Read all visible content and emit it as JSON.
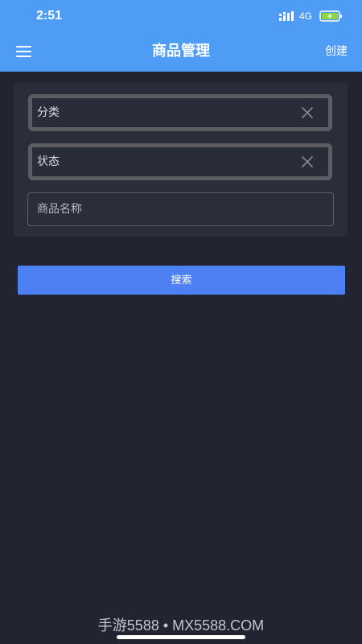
{
  "status_bar": {
    "time": "2:51",
    "network": "4G"
  },
  "header": {
    "title": "商品管理",
    "create_label": "创建",
    "menu_icon": "hamburger-menu-icon"
  },
  "filters": {
    "category": {
      "label": "分类",
      "clear_icon": "close-icon"
    },
    "status": {
      "label": "状态",
      "clear_icon": "close-icon"
    },
    "product_name": {
      "placeholder": "商品名称",
      "value": ""
    }
  },
  "search_button_label": "搜索",
  "watermark": "手游5588 • MX5588.COM",
  "colors": {
    "header_bg": "#4e9cf6",
    "page_bg": "#222531",
    "panel_bg": "#2a2d3a",
    "primary_button": "#4d80f3",
    "battery_charge": "#8ad83c"
  }
}
